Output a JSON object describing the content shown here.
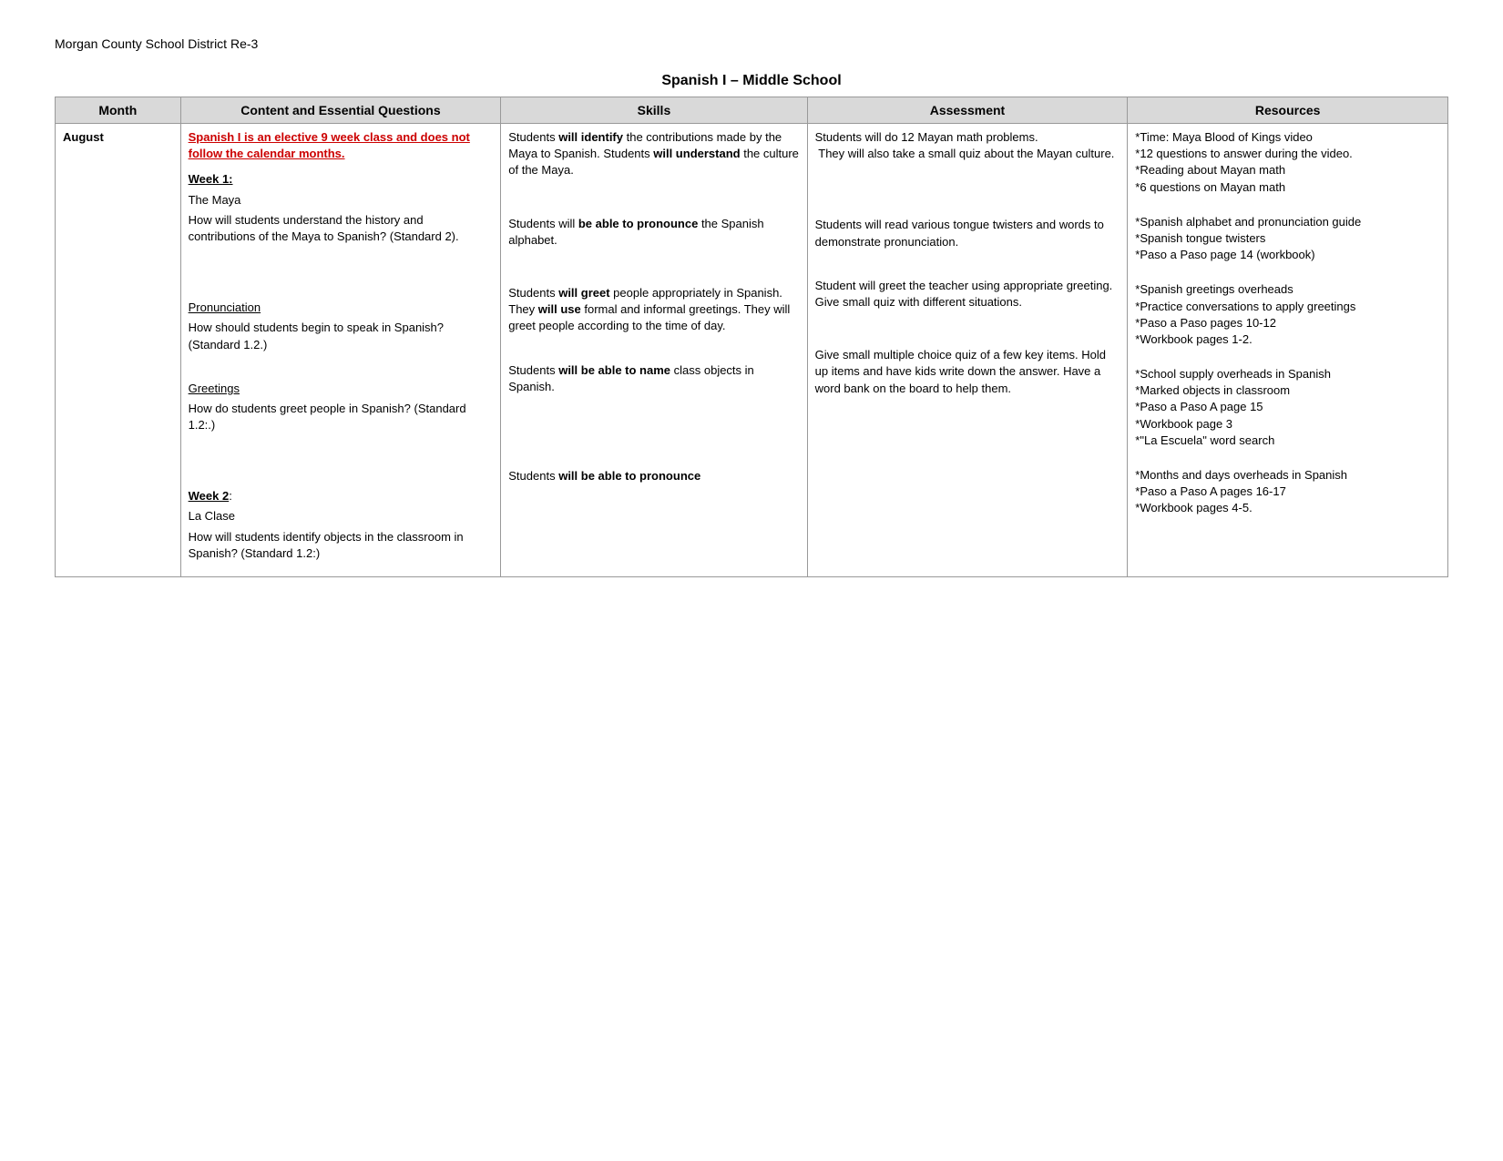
{
  "district": {
    "title": "Morgan County School District Re-3"
  },
  "course": {
    "title": "Spanish I – Middle School"
  },
  "table": {
    "headers": {
      "month": "Month",
      "content": "Content and Essential Questions",
      "skills": "Skills",
      "assessment": "Assessment",
      "resources": "Resources"
    },
    "rows": [
      {
        "month": "August",
        "content_intro_red": "Spanish I is an elective 9 week class and does not follow the calendar months.",
        "content_week1_label": "Week 1:",
        "content_topic1": "The Maya",
        "content_q1": "How will students understand the history and contributions of the Maya to Spanish? (Standard 2).",
        "content_pronunciation_label": "Pronunciation",
        "content_q2": "How should students begin to speak in Spanish? (Standard 1.2.)",
        "content_greetings_label": "Greetings",
        "content_q3": "How do students greet people in Spanish? (Standard 1.2:.)",
        "content_week2_label": "Week 2:",
        "content_topic2": "La Clase",
        "content_q4": "How will students identify objects in the classroom in Spanish? (Standard 1.2:)",
        "skills_blocks": [
          {
            "text_pre": "Students ",
            "text_bold": "will identify",
            "text_post": " the contributions made by the Maya to Spanish. Students ",
            "text_bold2": "will understand",
            "text_post2": " the culture of the Maya."
          },
          {
            "text_pre": "Students will ",
            "text_bold": "be able to pronounce",
            "text_post": " the Spanish alphabet."
          },
          {
            "text_pre": "Students ",
            "text_bold": "will greet",
            "text_post": " people appropriately in Spanish. They ",
            "text_bold2": "will use",
            "text_post2": " formal and informal greetings. They will greet people according to the time of day."
          },
          {
            "text_pre": "Students ",
            "text_bold": "will be able to name",
            "text_post": " class objects in Spanish."
          },
          {
            "text_pre": "Students ",
            "text_bold": "will be able to pronounce"
          }
        ],
        "assessment_blocks": [
          "Students will do 12 Mayan math problems.\n They will also take a small quiz about the Mayan culture.",
          "Students will read various tongue twisters and words to demonstrate pronunciation.",
          "Student will greet the teacher using appropriate greeting. Give small quiz with different situations.",
          "Give small multiple choice quiz of a few key items. Hold up items and have kids write down the answer. Have a word bank on the board to help them.",
          ""
        ],
        "resources_blocks": [
          "*Time: Maya Blood of Kings video\n*12 questions to answer during the video.\n*Reading about Mayan math\n*6 questions on Mayan math",
          "*Spanish alphabet and pronunciation guide\n*Spanish tongue twisters\n*Paso a Paso page 14 (workbook)",
          "*Spanish greetings overheads\n*Practice conversations to apply greetings\n*Paso a Paso pages 10-12\n*Workbook pages 1-2.",
          "*School supply overheads in Spanish\n*Marked objects in classroom\n*Paso a Paso A page 15\n*Workbook page 3\n*\"La Escuela\" word search",
          "*Months and days overheads in Spanish\n*Paso a Paso A pages 16-17\n*Workbook pages 4-5."
        ]
      }
    ]
  }
}
